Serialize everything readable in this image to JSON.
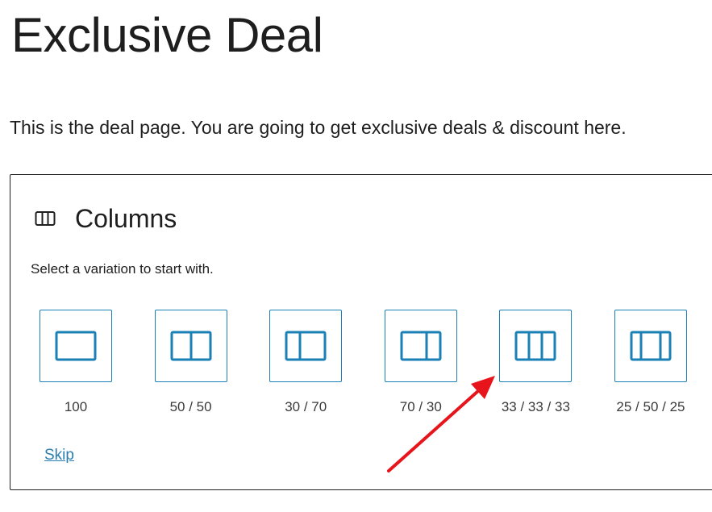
{
  "page": {
    "title": "Exclusive Deal",
    "intro": "This is the deal page. You are going to get exclusive deals & discount here."
  },
  "columns_block": {
    "icon": "columns-icon",
    "label": "Columns",
    "instructions": "Select a variation to start with.",
    "variations": [
      {
        "label": "100",
        "icon": "one-column-icon"
      },
      {
        "label": "50 / 50",
        "icon": "two-columns-equal-icon"
      },
      {
        "label": "30 / 70",
        "icon": "two-columns-30-70-icon"
      },
      {
        "label": "70 / 30",
        "icon": "two-columns-70-30-icon"
      },
      {
        "label": "33 / 33 / 33",
        "icon": "three-columns-equal-icon"
      },
      {
        "label": "25 / 50 / 25",
        "icon": "three-columns-wide-center-icon"
      }
    ],
    "skip_label": "Skip"
  },
  "annotation": {
    "arrow_color": "#e8141c",
    "points_to": "33 / 33 / 33"
  },
  "colors": {
    "accent": "#1a80b6",
    "link": "#2b7fb0",
    "text": "#1e1e1e"
  }
}
